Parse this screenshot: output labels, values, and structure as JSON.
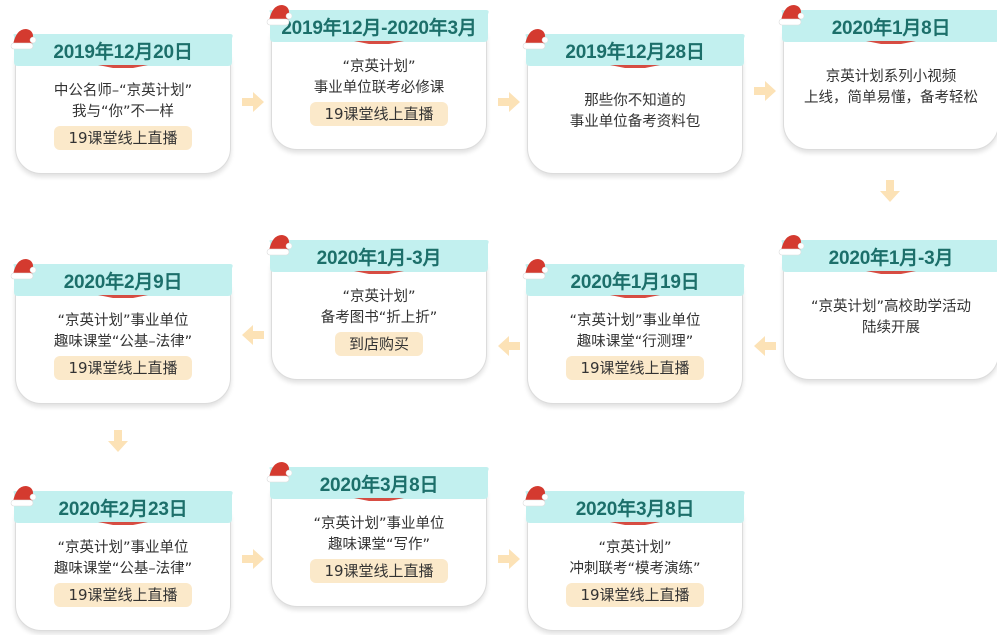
{
  "colors": {
    "banner": "#c2f0ef",
    "date_text": "#1c6f6a",
    "accent_red": "#d43a2f",
    "tag_bg": "#fbe9ca",
    "arrow": "#fce2b6"
  },
  "cards": [
    {
      "date": "2019年12月20日",
      "lines": [
        "中公名师–“京英计划”",
        "我与“你”不一样"
      ],
      "tag": "19课堂线上直播"
    },
    {
      "date": "2019年12月-2020年3月",
      "lines": [
        "“京英计划”",
        "事业单位联考必修课"
      ],
      "tag": "19课堂线上直播"
    },
    {
      "date": "2019年12月28日",
      "lines": [
        "那些你不知道的",
        "事业单位备考资料包"
      ],
      "tag": ""
    },
    {
      "date": "2020年1月8日",
      "lines": [
        "京英计划系列小视频",
        "上线，简单易懂，备考轻松"
      ],
      "tag": ""
    },
    {
      "date": "2020年1月-3月",
      "lines": [
        "“京英计划”高校助学活动",
        "陆续开展"
      ],
      "tag": ""
    },
    {
      "date": "2020年1月19日",
      "lines": [
        "“京英计划”事业单位",
        "趣味课堂“行测理”"
      ],
      "tag": "19课堂线上直播"
    },
    {
      "date": "2020年1月-3月",
      "lines": [
        "“京英计划”",
        "备考图书“折上折”"
      ],
      "tag": "到店购买"
    },
    {
      "date": "2020年2月9日",
      "lines": [
        "“京英计划”事业单位",
        "趣味课堂“公基–法律”"
      ],
      "tag": "19课堂线上直播"
    },
    {
      "date": "2020年2月23日",
      "lines": [
        "“京英计划”事业单位",
        "趣味课堂“公基–法律”"
      ],
      "tag": "19课堂线上直播"
    },
    {
      "date": "2020年3月8日",
      "lines": [
        "“京英计划”事业单位",
        "趣味课堂“写作”"
      ],
      "tag": "19课堂线上直播"
    },
    {
      "date": "2020年3月8日",
      "lines": [
        "“京英计划”",
        "冲刺联考“模考演练”"
      ],
      "tag": "19课堂线上直播"
    }
  ],
  "icons": {
    "hat": "santa-hat-icon",
    "arrow": "arrow-icon"
  }
}
